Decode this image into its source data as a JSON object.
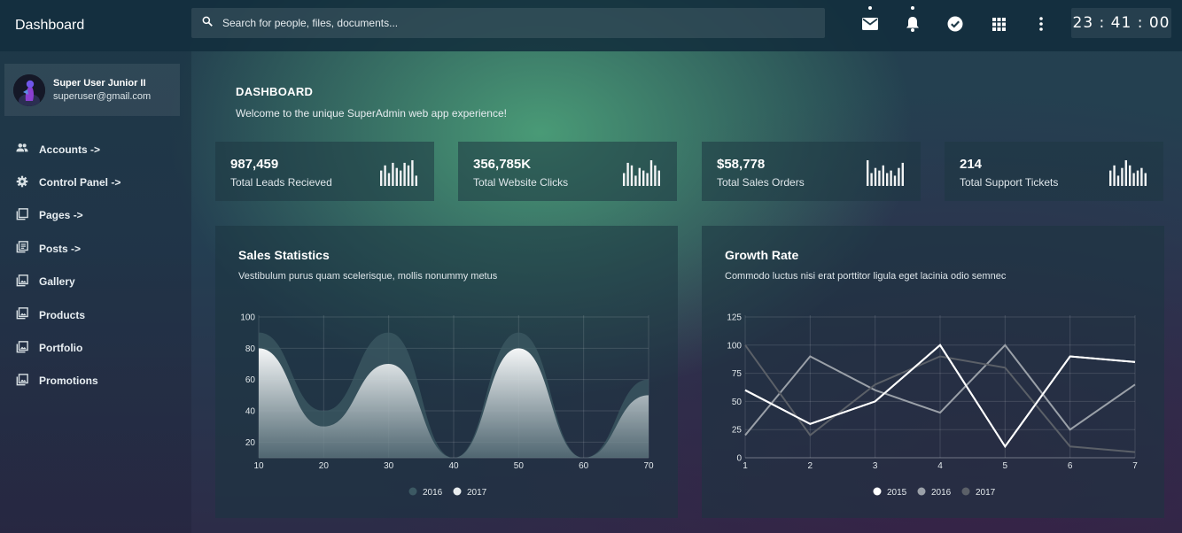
{
  "app": {
    "title": "Dashboard"
  },
  "search": {
    "placeholder": "Search for people, files, documents..."
  },
  "clock": {
    "time": "23 : 41 : 00"
  },
  "top_icons": [
    "mail-icon",
    "bell-icon",
    "check-circle-icon",
    "apps-grid-icon",
    "more-vert-icon"
  ],
  "user": {
    "name": "Super User Junior II",
    "email": "superuser@gmail.com"
  },
  "sidebar": {
    "items": [
      {
        "label": "Accounts ->",
        "icon": "people-icon"
      },
      {
        "label": "Control Panel ->",
        "icon": "gear-icon"
      },
      {
        "label": "Pages ->",
        "icon": "pages-icon"
      },
      {
        "label": "Posts ->",
        "icon": "posts-icon"
      },
      {
        "label": "Gallery",
        "icon": "gallery-icon"
      },
      {
        "label": "Products",
        "icon": "products-icon"
      },
      {
        "label": "Portfolio",
        "icon": "portfolio-icon"
      },
      {
        "label": "Promotions",
        "icon": "promotions-icon"
      }
    ]
  },
  "header": {
    "title": "DASHBOARD",
    "subtitle": "Welcome to the unique SuperAdmin web app experience!"
  },
  "stats": [
    {
      "value": "987,459",
      "label": "Total Leads Recieved",
      "spark": [
        6,
        8,
        5,
        9,
        7,
        6,
        9,
        8,
        10,
        4
      ]
    },
    {
      "value": "356,785K",
      "label": "Total Website Clicks",
      "spark": [
        5,
        9,
        8,
        4,
        7,
        6,
        5,
        10,
        8,
        6
      ]
    },
    {
      "value": "$58,778",
      "label": "Total Sales Orders",
      "spark": [
        10,
        5,
        7,
        6,
        8,
        5,
        6,
        4,
        7,
        9
      ]
    },
    {
      "value": "214",
      "label": "Total Support Tickets",
      "spark": [
        6,
        8,
        4,
        7,
        10,
        8,
        5,
        6,
        7,
        5
      ]
    }
  ],
  "sales_panel": {
    "title": "Sales Statistics",
    "subtitle": "Vestibulum purus quam scelerisque, mollis nonummy metus"
  },
  "growth_panel": {
    "title": "Growth Rate",
    "subtitle": "Commodo luctus nisi erat porttitor ligula eget lacinia odio semnec"
  },
  "chart_data": [
    {
      "type": "area",
      "x": [
        10,
        20,
        30,
        40,
        50,
        60,
        70
      ],
      "series": [
        {
          "name": "2016",
          "values": [
            90,
            40,
            90,
            10,
            90,
            10,
            60
          ],
          "color": "#3c5963"
        },
        {
          "name": "2017",
          "values": [
            80,
            30,
            70,
            10,
            80,
            10,
            50
          ],
          "color": "#e8ecee"
        }
      ],
      "ylim": [
        10,
        100
      ],
      "yticks": [
        20,
        40,
        60,
        80,
        100
      ],
      "xlabel": "",
      "ylabel": "",
      "grid": true,
      "legend": "bottom"
    },
    {
      "type": "line",
      "x": [
        1,
        2,
        3,
        4,
        5,
        6,
        7
      ],
      "series": [
        {
          "name": "2015",
          "values": [
            60,
            30,
            50,
            100,
            10,
            90,
            85
          ],
          "color": "#ffffff"
        },
        {
          "name": "2016",
          "values": [
            20,
            90,
            60,
            40,
            100,
            25,
            65
          ],
          "color": "#9aa0a8"
        },
        {
          "name": "2017",
          "values": [
            100,
            20,
            65,
            90,
            80,
            10,
            5
          ],
          "color": "#5b6068"
        }
      ],
      "ylim": [
        0,
        125
      ],
      "yticks": [
        0,
        25,
        50,
        75,
        100,
        125
      ],
      "xlabel": "",
      "ylabel": "",
      "grid": true,
      "legend": "bottom"
    }
  ]
}
